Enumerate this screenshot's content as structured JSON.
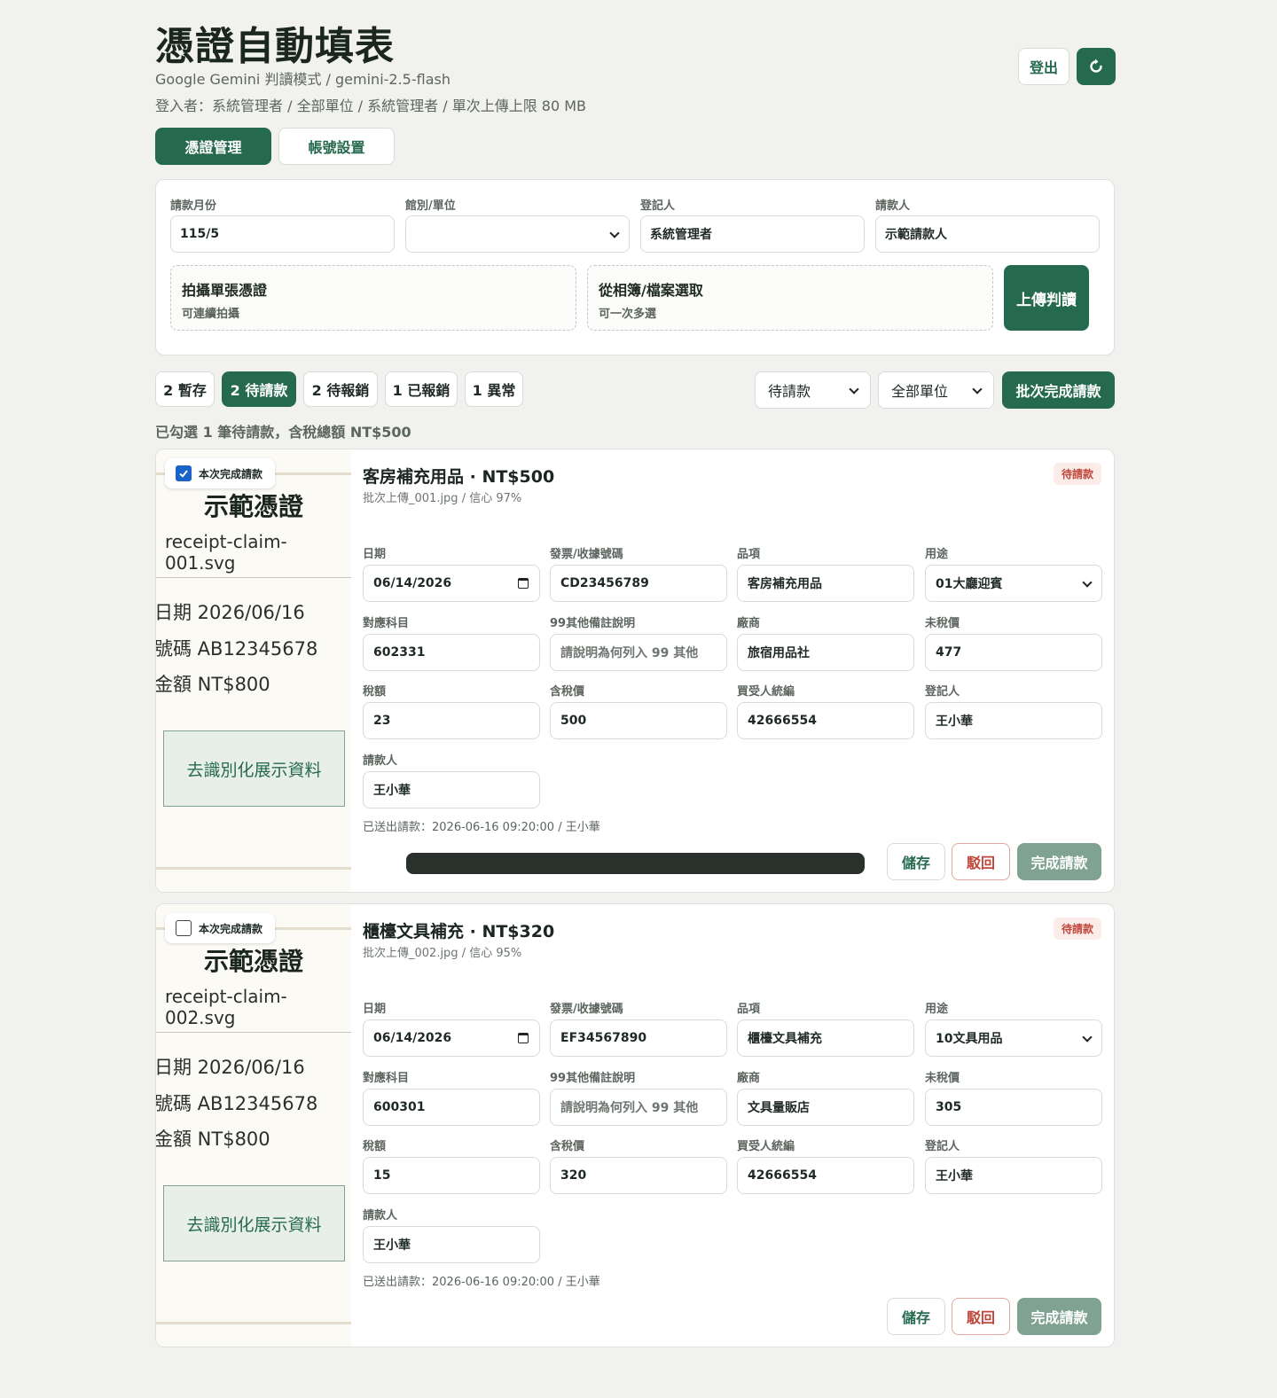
{
  "header": {
    "title": "憑證自動填表",
    "subtitle": "Google Gemini 判讀模式 / gemini-2.5-flash",
    "login_info": "登入者：系統管理者 / 全部單位 / 系統管理者 / 單次上傳上限 80 MB",
    "logout_label": "登出",
    "refresh_icon": "refresh-icon"
  },
  "tabs": [
    {
      "label": "憑證管理",
      "active": true
    },
    {
      "label": "帳號設置",
      "active": false
    }
  ],
  "upload": {
    "fields": [
      {
        "label": "請款月份",
        "value": "115/5"
      },
      {
        "label": "館別/單位",
        "value": ""
      },
      {
        "label": "登記人",
        "value": "系統管理者"
      },
      {
        "label": "請款人",
        "value": "示範請款人"
      }
    ],
    "camera": {
      "title": "拍攝單張憑證",
      "sub": "可連續拍攝"
    },
    "album": {
      "title": "從相簿/檔案選取",
      "sub": "可一次多選"
    },
    "submit_label": "上傳判讀"
  },
  "filters": {
    "chips": [
      {
        "label": "2 暫存",
        "active": false
      },
      {
        "label": "2 待請款",
        "active": true
      },
      {
        "label": "2 待報銷",
        "active": false
      },
      {
        "label": "1 已報銷",
        "active": false
      },
      {
        "label": "1 異常",
        "active": false
      }
    ],
    "status_select": "待請款",
    "unit_select": "全部單位",
    "batch_label": "批次完成請款",
    "summary": "已勾選 1 筆待請款，含稅總額 NT$500"
  },
  "labels": {
    "checkbox": "本次完成請款",
    "date": "日期",
    "invoice_no": "發票/收據號碼",
    "item": "品項",
    "purpose": "用途",
    "account": "對應科目",
    "note99": "99其他備註說明",
    "vendor": "廠商",
    "pretax": "未稅價",
    "tax": "稅額",
    "total": "含稅價",
    "buyer_id": "買受人統編",
    "registrant": "登記人",
    "claimant": "請款人",
    "save": "儲存",
    "reject": "駁回",
    "done": "完成請款",
    "deid": "去識別化展示資料",
    "sample": "示範憑證"
  },
  "cards": [
    {
      "checked": true,
      "title": "客房補充用品 · NT$500",
      "meta": "批次上傳_001.jpg / 信心 97%",
      "status": "待請款",
      "thumb": {
        "filename": "receipt-claim-001.svg",
        "date": "日期 2026/06/16",
        "number": "號碼 AB12345678",
        "amount": "金額 NT$800"
      },
      "date": "06/14/2026",
      "invoice_no": "CD23456789",
      "item": "客房補充用品",
      "purpose": "01大廳迎賓",
      "account": "602331",
      "note99_placeholder": "請說明為何列入 99 其他",
      "vendor": "旅宿用品社",
      "pretax": "477",
      "tax": "23",
      "total": "500",
      "buyer_id": "42666554",
      "registrant": "王小華",
      "claimant": "王小華",
      "sent": "已送出請款：2026-06-16 09:20:00 / 王小華",
      "progress": 1.0
    },
    {
      "checked": false,
      "title": "櫃檯文具補充 · NT$320",
      "meta": "批次上傳_002.jpg / 信心 95%",
      "status": "待請款",
      "thumb": {
        "filename": "receipt-claim-002.svg",
        "date": "日期 2026/06/16",
        "number": "號碼 AB12345678",
        "amount": "金額 NT$800"
      },
      "date": "06/14/2026",
      "invoice_no": "EF34567890",
      "item": "櫃檯文具補充",
      "purpose": "10文具用品",
      "account": "600301",
      "note99_placeholder": "請說明為何列入 99 其他",
      "vendor": "文具量販店",
      "pretax": "305",
      "tax": "15",
      "total": "320",
      "buyer_id": "42666554",
      "registrant": "王小華",
      "claimant": "王小華",
      "sent": "已送出請款：2026-06-16 09:20:00 / 王小華"
    }
  ]
}
